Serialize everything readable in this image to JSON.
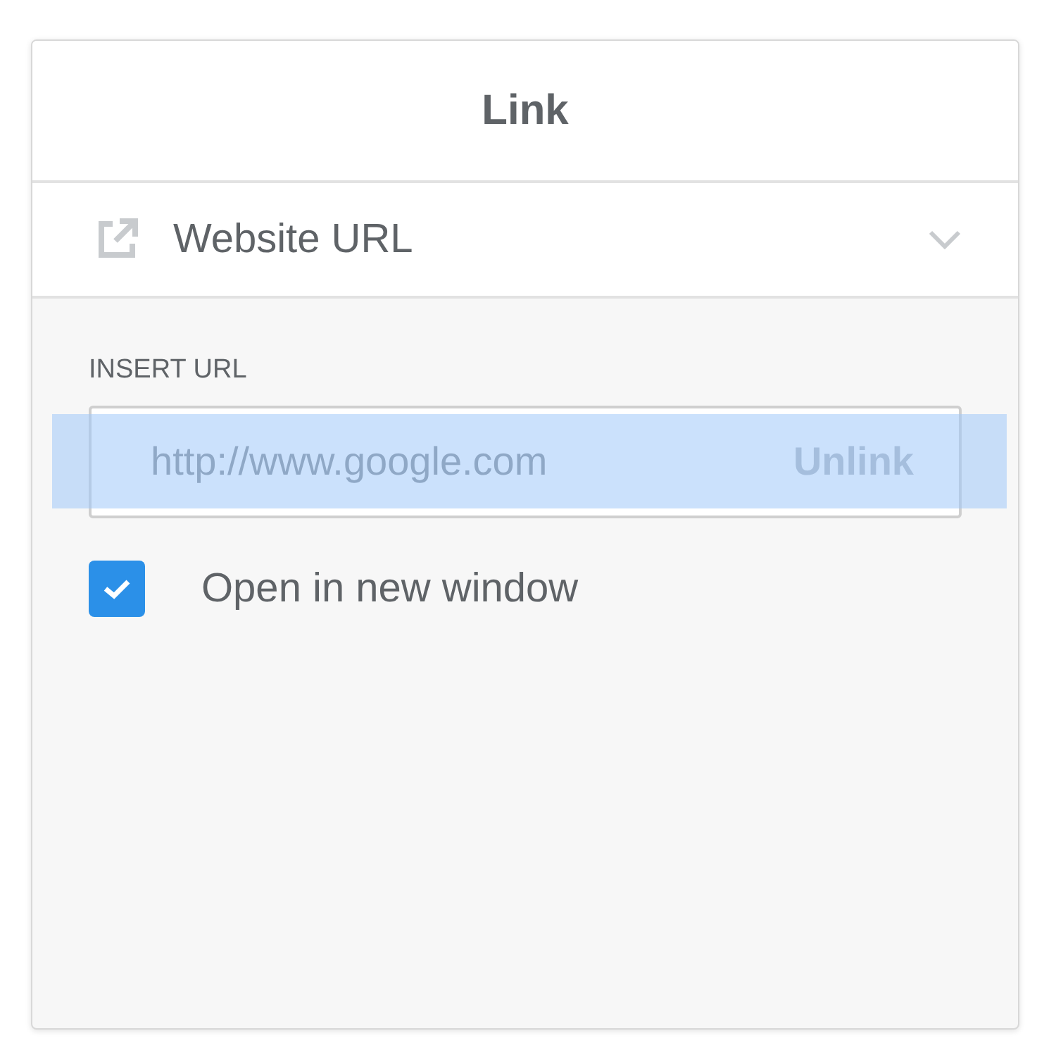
{
  "dialog": {
    "title": "Link"
  },
  "link_type": {
    "label": "Website URL",
    "expanded": false
  },
  "url_field": {
    "label": "INSERT URL",
    "value": "http://www.google.com",
    "highlighted": true
  },
  "unlink_button": {
    "label": "Unlink"
  },
  "new_window": {
    "label": "Open in new window",
    "checked": true
  }
}
